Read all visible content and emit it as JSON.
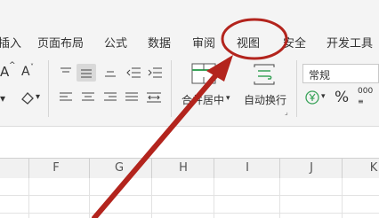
{
  "ribbon": {
    "tabs": [
      "插入",
      "页面布局",
      "公式",
      "数据",
      "审阅",
      "视图",
      "安全",
      "开发工具"
    ]
  },
  "toolbar": {
    "font_grow": "A",
    "font_shrink": "A",
    "merge_center": "合并居中",
    "wrap_text": "自动换行",
    "number_format": "常规",
    "percent": "%",
    "thousands": "000"
  },
  "columns": [
    "F",
    "G",
    "H",
    "I",
    "J",
    "K"
  ],
  "annotation": {
    "color": "#b3241d"
  }
}
